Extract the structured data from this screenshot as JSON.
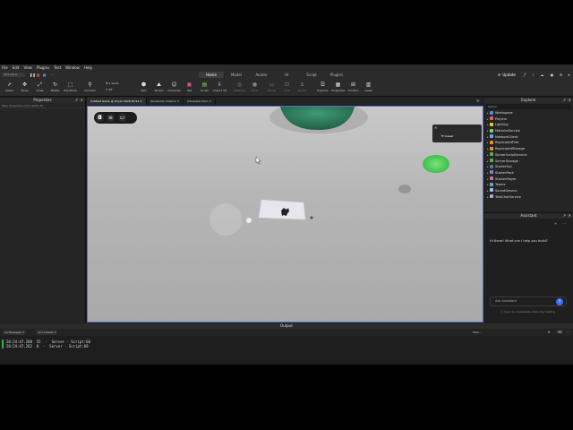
{
  "menu": [
    "File",
    "Edit",
    "View",
    "Plugins",
    "Test",
    "Window",
    "Help"
  ],
  "topbar": {
    "place_pill": "Test place",
    "main_tabs": [
      {
        "label": "Home",
        "active": true
      },
      {
        "label": "Model",
        "active": false
      },
      {
        "label": "Avatar",
        "active": false
      },
      {
        "label": "UI",
        "active": false
      },
      {
        "label": "Script",
        "active": false
      },
      {
        "label": "Plugins",
        "active": false
      }
    ],
    "update_label": "Update"
  },
  "ribbon": {
    "tools": [
      "Select",
      "Move",
      "Scale",
      "Rotate",
      "Transform",
      "Connect"
    ],
    "snap_move": "1 studs",
    "snap_rotate": "45°",
    "insert": [
      "Part",
      "Terrain",
      "Character",
      "GUI",
      "Script",
      "Import 3D"
    ],
    "edit": [
      "Material",
      "Color",
      "Group",
      "Lock",
      "Anchor"
    ],
    "panels": [
      "Explorer",
      "Properties",
      "Toolbox",
      "Asset"
    ]
  },
  "properties": {
    "title": "Properties",
    "filter_placeholder": "Filter Properties (Ctrl+Shift+P)"
  },
  "doc_tabs": [
    {
      "label": "Untitled Game @ 20 Jan 2026 20:24",
      "active": true
    },
    {
      "label": "[Disabled] Initialize",
      "active": false
    },
    {
      "label": "[Disabled] Main",
      "active": false
    }
  ],
  "viewport": {
    "popup_label": "lowest"
  },
  "explorer": {
    "title": "Explorer",
    "search_placeholder": "Search",
    "items": [
      {
        "label": "Workspace",
        "color": "#4a90e2",
        "expandable": true
      },
      {
        "label": "Players",
        "color": "#e06666",
        "expandable": true
      },
      {
        "label": "Lighting",
        "color": "#f1c232",
        "expandable": true
      },
      {
        "label": "MaterialService",
        "color": "#93c47d",
        "expandable": true
      },
      {
        "label": "NetworkClient",
        "color": "#6fa8dc",
        "expandable": true
      },
      {
        "label": "ReplicatedFirst",
        "color": "#e69138",
        "expandable": true
      },
      {
        "label": "ReplicatedStorage",
        "color": "#e69138",
        "expandable": true
      },
      {
        "label": "ServerScriptService",
        "color": "#6aa84f",
        "expandable": true
      },
      {
        "label": "ServerStorage",
        "color": "#6aa84f",
        "expandable": true
      },
      {
        "label": "StarterGui",
        "color": "#45818e",
        "expandable": true
      },
      {
        "label": "StarterPack",
        "color": "#8e7cc3",
        "expandable": true
      },
      {
        "label": "StarterPlayer",
        "color": "#c27ba0",
        "expandable": true
      },
      {
        "label": "Teams",
        "color": "#76a5af",
        "expandable": true
      },
      {
        "label": "SoundService",
        "color": "#a4c2f4",
        "expandable": true
      },
      {
        "label": "TextChatService",
        "color": "#b4a7d6",
        "expandable": true
      }
    ]
  },
  "assistant": {
    "title": "Assistant",
    "greeting": "Hi there! What can I help you build?",
    "input_placeholder": "Ask Assistant",
    "note": "Input is unavailable while play testing"
  },
  "output": {
    "title": "Output",
    "filter_messages": "All Messages",
    "filter_contexts": "All Contexts",
    "filter_label": "Filter...",
    "lines": [
      "20:24:47.260  55  -  Server - Script:68",
      "20:24:47.262  0  -  Server - Script:69"
    ]
  }
}
